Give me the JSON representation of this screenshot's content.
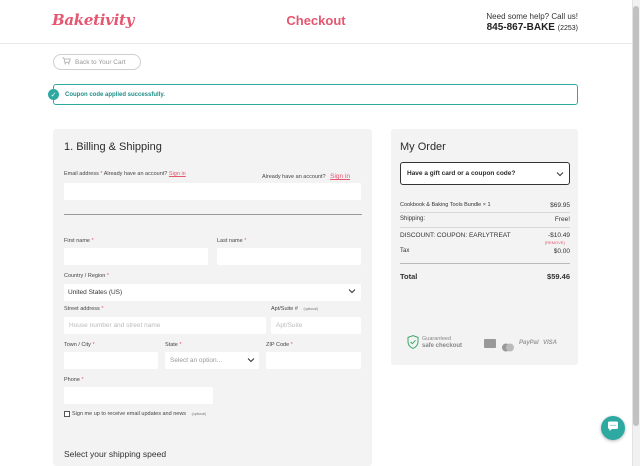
{
  "header": {
    "logo": "Baketivity",
    "title": "Checkout",
    "help_text": "Need some help? Call us!",
    "phone": "845-867-BAKE",
    "phone_ext": "(2253)"
  },
  "back_button": "Back to Your Cart",
  "notice": "Coupon code applied successfully.",
  "billing": {
    "heading": "1. Billing & Shipping",
    "email_label": "Email address",
    "email_hint": "Already have an account?",
    "sign_in": "Sign in",
    "already_account": "Already have an account?",
    "sign_in_2": "Sign in",
    "first_name_label": "First name",
    "last_name_label": "Last name",
    "country_label": "Country / Region",
    "country_value": "United States (US)",
    "street_label": "Street address",
    "street_placeholder": "House number and street name",
    "apt_label": "Apt/Suite #",
    "apt_optional": "(optional)",
    "apt_placeholder": "Apt/Suite",
    "city_label": "Town / City",
    "state_label": "State",
    "state_placeholder": "Select an option...",
    "zip_label": "ZIP Code",
    "phone_label": "Phone",
    "signup_label": "Sign me up to receive email updates and news",
    "signup_optional": "(optional)",
    "shipping_speed": "Select your shipping speed",
    "required_mark": "*"
  },
  "order": {
    "heading": "My Order",
    "gift_prompt": "Have a gift card or a coupon code?",
    "item_name": "Cookbook & Baking Tools Bundle × 1",
    "item_price": "$69.95",
    "shipping_label": "Shipping:",
    "shipping_value": "Free!",
    "discount_label": "DISCOUNT: COUPON: EARLYTREAT",
    "discount_value": "-$10.49",
    "remove_label": "[REMOVE]",
    "tax_label": "Tax",
    "tax_value": "$0.00",
    "total_label": "Total",
    "total_value": "$59.46",
    "guaranteed_1": "Guaranteed",
    "guaranteed_2": "safe checkout",
    "paypal": "PayPal",
    "visa": "VISA"
  },
  "colors": {
    "brand": "#e5566f",
    "accent": "#2ea9a1"
  }
}
